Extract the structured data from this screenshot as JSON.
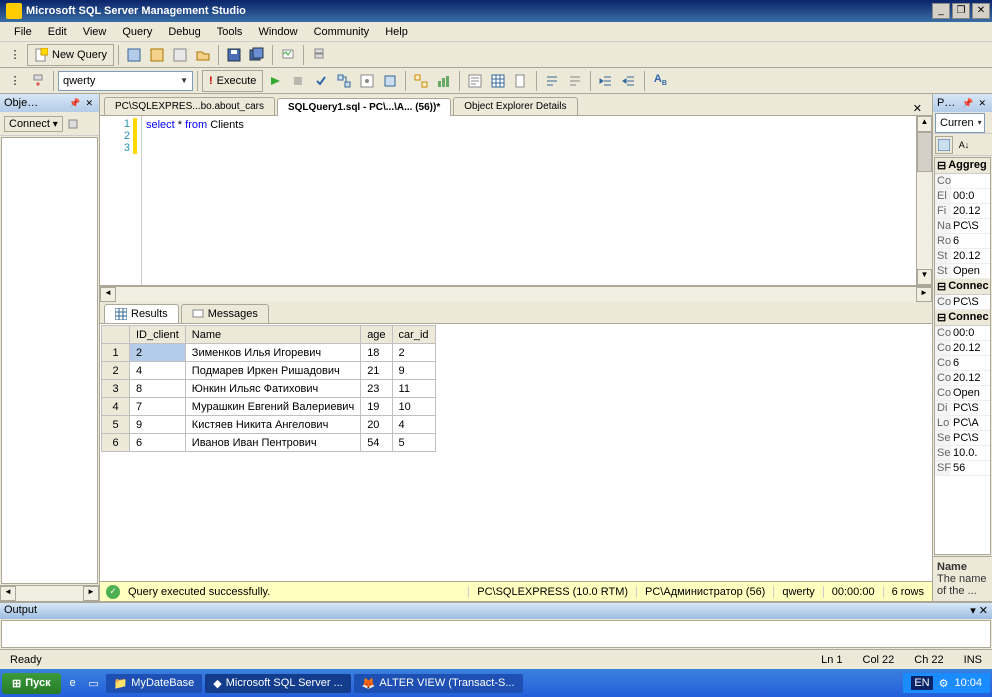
{
  "title": "Microsoft SQL Server Management Studio",
  "menu": [
    "File",
    "Edit",
    "View",
    "Query",
    "Debug",
    "Tools",
    "Window",
    "Community",
    "Help"
  ],
  "toolbar1": {
    "new_query": "New Query"
  },
  "toolbar2": {
    "db_dropdown": "qwerty",
    "execute": "Execute"
  },
  "obj_explorer": {
    "title": "Obje…",
    "connect": "Connect"
  },
  "tabs": {
    "items": [
      {
        "label": "PC\\SQLEXPRES...bo.about_cars"
      },
      {
        "label": "SQLQuery1.sql - PC\\...\\А... (56))*"
      },
      {
        "label": "Object Explorer Details"
      }
    ],
    "active": 1
  },
  "editor": {
    "lines": [
      "1",
      "2",
      "3"
    ],
    "code_kw1": "select",
    "code_star": " * ",
    "code_kw2": "from",
    "code_sp": " ",
    "code_ident": "Clients"
  },
  "results_tabs": {
    "results": "Results",
    "messages": "Messages"
  },
  "grid": {
    "columns": [
      "ID_client",
      "Name",
      "age",
      "car_id"
    ],
    "rows": [
      {
        "n": "1",
        "ID_client": "2",
        "Name": "Зименков Илья Игоревич",
        "age": "18",
        "car_id": "2"
      },
      {
        "n": "2",
        "ID_client": "4",
        "Name": "Подмарев Иркен Ришадович",
        "age": "21",
        "car_id": "9"
      },
      {
        "n": "3",
        "ID_client": "8",
        "Name": "Юнкин Ильяс Фатихович",
        "age": "23",
        "car_id": "11"
      },
      {
        "n": "4",
        "ID_client": "7",
        "Name": "Мурашкин Евгений Валериевич",
        "age": "19",
        "car_id": "10"
      },
      {
        "n": "5",
        "ID_client": "9",
        "Name": "Кистяев Никита Ангелович",
        "age": "20",
        "car_id": "4"
      },
      {
        "n": "6",
        "ID_client": "6",
        "Name": "Иванов Иван Пентрович",
        "age": "54",
        "car_id": "5"
      }
    ]
  },
  "query_status": {
    "msg": "Query executed successfully.",
    "server": "PC\\SQLEXPRESS (10.0 RTM)",
    "user": "PC\\Администратор (56)",
    "db": "qwerty",
    "time": "00:00:00",
    "rows": "6 rows"
  },
  "properties": {
    "title": "P…",
    "dropdown": "Curren",
    "cat1": "Aggreg",
    "rows1": [
      {
        "k": "Co",
        "v": ""
      },
      {
        "k": "El",
        "v": "00:0"
      },
      {
        "k": "Fi",
        "v": "20.12"
      },
      {
        "k": "Na",
        "v": "PC\\S"
      },
      {
        "k": "Ro",
        "v": "6"
      },
      {
        "k": "St",
        "v": "20.12"
      },
      {
        "k": "St",
        "v": "Open"
      }
    ],
    "cat2": "Connec",
    "rows2": [
      {
        "k": "Co",
        "v": "PC\\S"
      }
    ],
    "cat3": "Connec",
    "rows3": [
      {
        "k": "Co",
        "v": "00:0"
      },
      {
        "k": "Co",
        "v": "20.12"
      },
      {
        "k": "Co",
        "v": "6"
      },
      {
        "k": "Co",
        "v": "20.12"
      },
      {
        "k": "Co",
        "v": "Open"
      },
      {
        "k": "Di",
        "v": "PC\\S"
      },
      {
        "k": "Lo",
        "v": "PC\\А"
      },
      {
        "k": "Se",
        "v": "PC\\S"
      },
      {
        "k": "Se",
        "v": "10.0."
      },
      {
        "k": "SF",
        "v": "56"
      }
    ],
    "desc_name": "Name",
    "desc_text": "The name of the ..."
  },
  "output": {
    "title": "Output"
  },
  "statusbar": {
    "ready": "Ready",
    "ln": "Ln 1",
    "col": "Col 22",
    "ch": "Ch 22",
    "ins": "INS"
  },
  "taskbar": {
    "start": "Пуск",
    "folder": "MyDateBase",
    "ssms": "Microsoft SQL Server ...",
    "firefox": "ALTER VIEW (Transact-S...",
    "lang": "EN",
    "clock": "10:04"
  }
}
